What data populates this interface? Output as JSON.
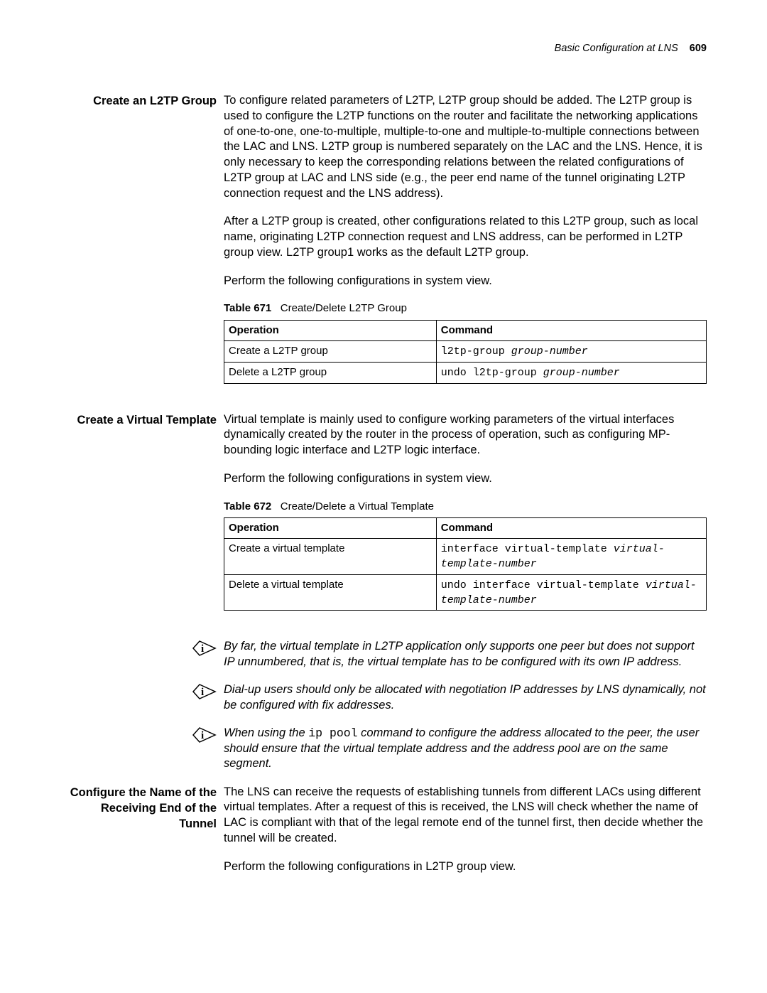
{
  "header": {
    "section": "Basic Configuration at LNS",
    "page_number": "609"
  },
  "sections": [
    {
      "heading": "Create an L2TP Group",
      "paragraphs": [
        "To configure related parameters of L2TP, L2TP group should be added. The L2TP group is used to configure the L2TP functions on the router and facilitate the networking applications of one-to-one, one-to-multiple, multiple-to-one and multiple-to-multiple connections between the LAC and LNS. L2TP group is numbered separately on the LAC and the LNS. Hence, it is only necessary to keep the corresponding relations between the related configurations of L2TP group at LAC and LNS side (e.g., the peer end name of the tunnel originating L2TP connection request and the LNS address).",
        "After a L2TP group is created, other configurations related to this L2TP group, such as local name, originating L2TP connection request and LNS address, can be performed in L2TP group view. L2TP group1 works as the default L2TP group.",
        "Perform the following configurations in system view."
      ],
      "table": {
        "number": "Table 671",
        "title": "Create/Delete L2TP Group",
        "col1": "Operation",
        "col2": "Command",
        "rows": [
          {
            "op": "Create a L2TP group",
            "cmd": "l2tp-group ",
            "arg": "group-number"
          },
          {
            "op": "Delete a L2TP group",
            "cmd": "undo l2tp-group ",
            "arg": "group-number"
          }
        ]
      }
    },
    {
      "heading": "Create a Virtual Template",
      "paragraphs": [
        "Virtual template is mainly used to configure working parameters of the virtual interfaces dynamically created by the router in the process of operation, such as configuring MP-bounding logic interface and L2TP logic interface.",
        "Perform the following configurations in system view."
      ],
      "table": {
        "number": "Table 672",
        "title": "Create/Delete a Virtual Template",
        "col1": "Operation",
        "col2": "Command",
        "rows": [
          {
            "op": "Create a virtual template",
            "cmd": "interface virtual-template ",
            "arg": "virtual-template-number"
          },
          {
            "op": "Delete a virtual template",
            "cmd": "undo interface virtual-template ",
            "arg": "virtual-template-number"
          }
        ]
      }
    }
  ],
  "notes": [
    "By far, the virtual template in L2TP application only supports one peer but does not support IP unnumbered, that is, the virtual template has to be configured with its own IP address.",
    "Dial-up users should only be allocated with negotiation IP addresses by LNS dynamically, not be configured with fix addresses."
  ],
  "note_ippool": {
    "pre": "When using the ",
    "code": "ip pool",
    "post": " command to configure the address allocated to the peer, the user should ensure that the virtual template address and the address pool are on the same segment."
  },
  "section_receiving": {
    "heading": "Configure the Name of the Receiving End of the Tunnel",
    "paragraphs": [
      "The LNS can receive the requests of establishing tunnels from different LACs using different virtual templates. After a request of this is received, the LNS will check whether the name of LAC is compliant with that of the legal remote end of the tunnel first, then decide whether the tunnel will be created.",
      "Perform the following configurations in L2TP group view."
    ]
  }
}
